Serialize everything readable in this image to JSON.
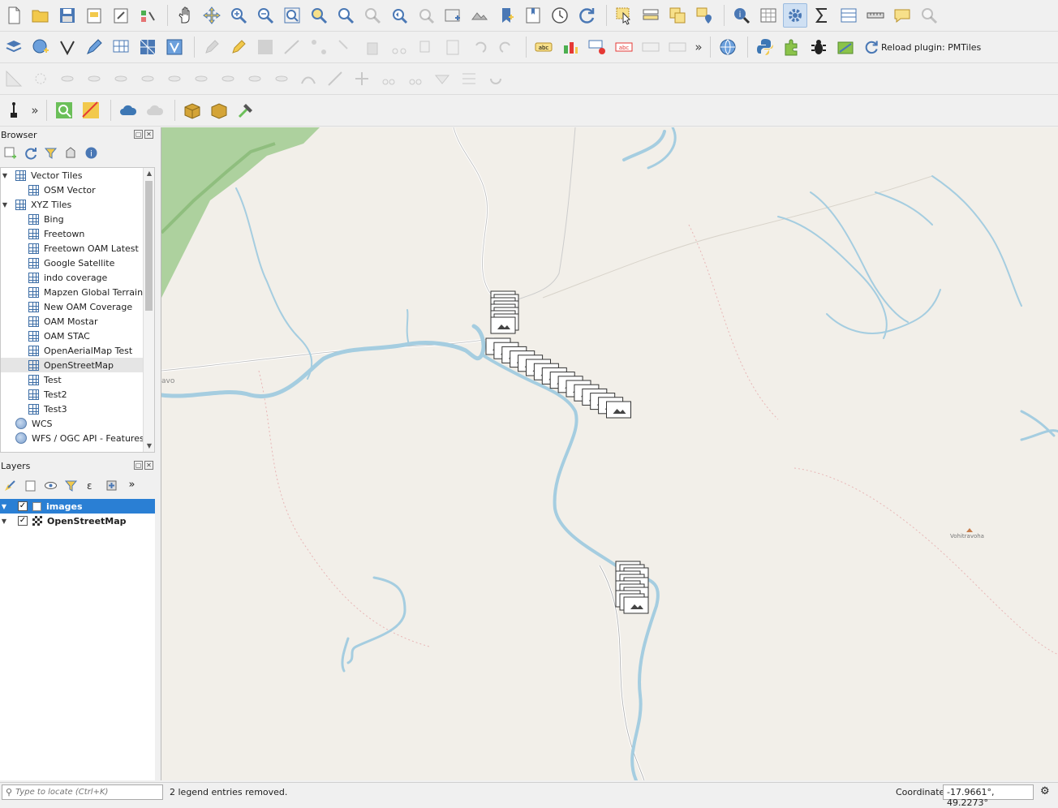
{
  "toolbar": {
    "reload_plugin_label": "Reload plugin: PMTiles"
  },
  "browser": {
    "title": "Browser",
    "items": [
      {
        "label": "Vector Tiles",
        "level": 0,
        "expanded": true,
        "icon": "grid-icon"
      },
      {
        "label": "OSM Vector",
        "level": 1,
        "icon": "grid-icon"
      },
      {
        "label": "XYZ Tiles",
        "level": 0,
        "expanded": true,
        "icon": "grid-icon"
      },
      {
        "label": "Bing",
        "level": 1,
        "icon": "grid-icon"
      },
      {
        "label": "Freetown",
        "level": 1,
        "icon": "grid-icon"
      },
      {
        "label": "Freetown OAM Latest",
        "level": 1,
        "icon": "grid-icon"
      },
      {
        "label": "Google Satellite",
        "level": 1,
        "icon": "grid-icon"
      },
      {
        "label": "indo coverage",
        "level": 1,
        "icon": "grid-icon"
      },
      {
        "label": "Mapzen Global Terrain",
        "level": 1,
        "icon": "grid-icon"
      },
      {
        "label": "New OAM Coverage",
        "level": 1,
        "icon": "grid-icon"
      },
      {
        "label": "OAM Mostar",
        "level": 1,
        "icon": "grid-icon"
      },
      {
        "label": "OAM STAC",
        "level": 1,
        "icon": "grid-icon"
      },
      {
        "label": "OpenAerialMap Test",
        "level": 1,
        "icon": "grid-icon"
      },
      {
        "label": "OpenStreetMap",
        "level": 1,
        "icon": "grid-icon",
        "selected": true
      },
      {
        "label": "Test",
        "level": 1,
        "icon": "grid-icon"
      },
      {
        "label": "Test2",
        "level": 1,
        "icon": "grid-icon"
      },
      {
        "label": "Test3",
        "level": 1,
        "icon": "grid-icon"
      },
      {
        "label": "WCS",
        "level": 0,
        "icon": "globe-icon"
      },
      {
        "label": "WFS / OGC API - Features",
        "level": 0,
        "icon": "globe-icon"
      }
    ]
  },
  "layers": {
    "title": "Layers",
    "items": [
      {
        "label": "images",
        "checked": true,
        "selected": true
      },
      {
        "label": "OpenStreetMap",
        "checked": true,
        "selected": false
      }
    ]
  },
  "map": {
    "place_labels": [
      "avo",
      "Vohitravoha"
    ]
  },
  "status": {
    "locator_placeholder": "Type to locate (Ctrl+K)",
    "message": "2 legend entries removed.",
    "coordinate_label": "Coordinate",
    "coordinate_value": "-17.9661°, 49.2273°"
  }
}
